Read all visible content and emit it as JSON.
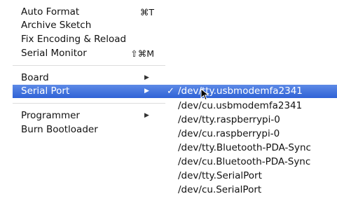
{
  "menu": {
    "items": [
      {
        "label": "Auto Format",
        "shortcut": "⌘T"
      },
      {
        "label": "Archive Sketch"
      },
      {
        "label": "Fix Encoding & Reload"
      },
      {
        "label": "Serial Monitor",
        "shortcut": "⇧⌘M"
      },
      {
        "label": "Board",
        "arrow": "▶"
      },
      {
        "label": "Serial Port",
        "arrow": "▶"
      },
      {
        "label": "Programmer",
        "arrow": "▶"
      },
      {
        "label": "Burn Bootloader"
      }
    ]
  },
  "submenu": {
    "check": "✓",
    "items": [
      {
        "label": "/dev/tty.usbmodemfa2341",
        "selected": true
      },
      {
        "label": "/dev/cu.usbmodemfa2341"
      },
      {
        "label": "/dev/tty.raspberrypi-0"
      },
      {
        "label": "/dev/cu.raspberrypi-0"
      },
      {
        "label": "/dev/tty.Bluetooth-PDA-Sync"
      },
      {
        "label": "/dev/cu.Bluetooth-PDA-Sync"
      },
      {
        "label": "/dev/tty.SerialPort"
      },
      {
        "label": "/dev/cu.SerialPort"
      }
    ]
  },
  "colors": {
    "highlight": "#3a6fdc"
  }
}
